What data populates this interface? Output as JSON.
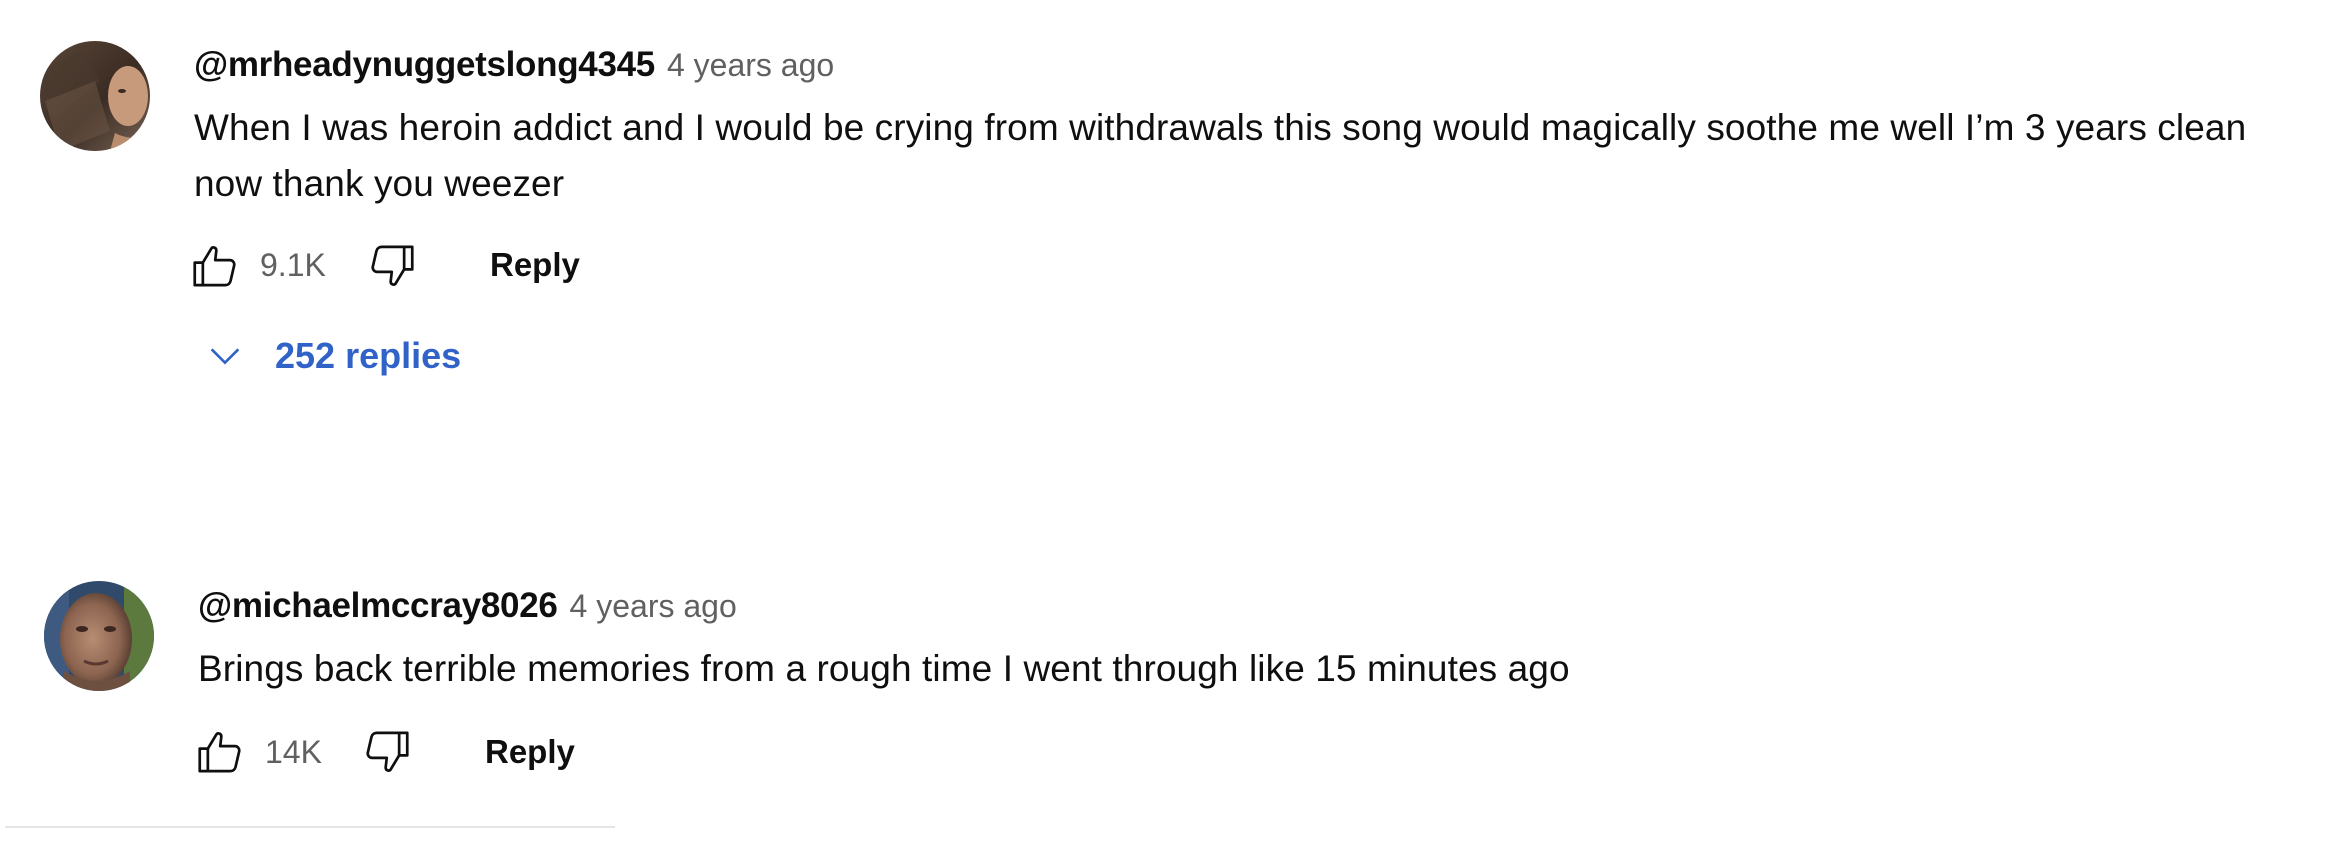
{
  "comments": [
    {
      "author": "@mrheadynuggetslong4345",
      "time": "4 years ago",
      "text_line1": "When I was heroin addict and I would be crying from withdrawals this song would magically soothe me well I’m 3 years clean",
      "text_line2": "now thank you weezer",
      "likes": "9.1K",
      "reply_label": "Reply",
      "replies_label": "252 replies",
      "avatar_icon": "user-photo-avatar"
    },
    {
      "author": "@michaelmccray8026",
      "time": "4 years ago",
      "text_line1": "Brings back terrible memories from a rough time I went through like 15 minutes ago",
      "likes": "14K",
      "reply_label": "Reply",
      "avatar_icon": "user-photo-avatar"
    }
  ],
  "icons": {
    "like": "thumbs-up-icon",
    "dislike": "thumbs-down-icon",
    "expand": "chevron-down-icon"
  },
  "colors": {
    "text": "#0f0f0f",
    "secondary": "#606060",
    "link": "#3062c8"
  }
}
